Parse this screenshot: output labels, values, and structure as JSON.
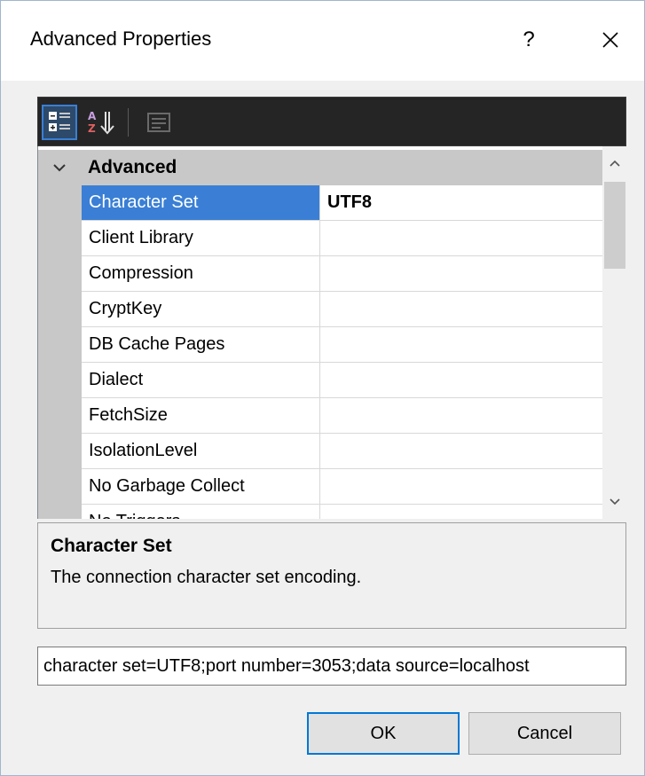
{
  "window": {
    "title": "Advanced Properties",
    "help_label": "?",
    "close_icon": "close-icon"
  },
  "toolbar": {
    "buttons": [
      {
        "icon": "categorized-icon",
        "active": true
      },
      {
        "icon": "alphabetical-sort-icon",
        "active": false
      },
      {
        "icon": "property-pages-icon",
        "active": false,
        "disabled": true
      }
    ]
  },
  "grid": {
    "category": {
      "label": "Advanced",
      "expanded": true
    },
    "properties": [
      {
        "name": "Character Set",
        "value": "UTF8",
        "selected": true
      },
      {
        "name": "Client Library",
        "value": ""
      },
      {
        "name": "Compression",
        "value": ""
      },
      {
        "name": "CryptKey",
        "value": ""
      },
      {
        "name": "DB Cache Pages",
        "value": ""
      },
      {
        "name": "Dialect",
        "value": ""
      },
      {
        "name": "FetchSize",
        "value": ""
      },
      {
        "name": "IsolationLevel",
        "value": ""
      },
      {
        "name": "No Garbage Collect",
        "value": ""
      },
      {
        "name": "No Triggers",
        "value": ""
      }
    ]
  },
  "description": {
    "title": "Character Set",
    "text": "The connection character set encoding."
  },
  "connection_string": "character set=UTF8;port number=3053;data source=localhost",
  "buttons": {
    "ok": "OK",
    "cancel": "Cancel"
  },
  "colors": {
    "selection": "#3a7fd5",
    "toolbar_bg": "#252526",
    "category_bg": "#c8c8c8",
    "dialog_bg": "#f0f0f0",
    "default_button_border": "#0078d7"
  }
}
